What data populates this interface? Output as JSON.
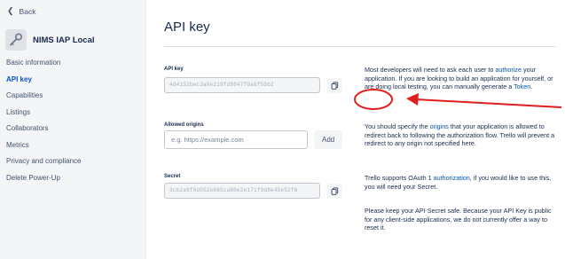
{
  "sidebar": {
    "back_label": "Back",
    "app_name": "NIMS IAP Local",
    "items": [
      {
        "label": "Basic information",
        "active": false
      },
      {
        "label": "API key",
        "active": true
      },
      {
        "label": "Capabilities",
        "active": false
      },
      {
        "label": "Listings",
        "active": false
      },
      {
        "label": "Collaborators",
        "active": false
      },
      {
        "label": "Metrics",
        "active": false
      },
      {
        "label": "Privacy and compliance",
        "active": false
      },
      {
        "label": "Delete Power-Up",
        "active": false
      }
    ]
  },
  "main": {
    "title": "API key",
    "api_key": {
      "label": "API key",
      "masked_value": "4d4152bec3a0e219fd9847f0a6f59b2"
    },
    "origins": {
      "label": "Allowed origins",
      "placeholder": "e.g. https://example.com",
      "add_label": "Add"
    },
    "secret": {
      "label": "Secret",
      "masked_value": "3cb2a9f0d052e865ca80e2e171f0d8e45e52f6"
    },
    "help": {
      "api_key_pre": "Most developers will need to ask each user to ",
      "api_key_link": "authorize",
      "api_key_mid": " your application. If you are looking to build an application for yourself, or are doing local testing, you can manually generate a ",
      "api_key_token_link": "Token",
      "api_key_post": ".",
      "origins_pre": "You should specify the ",
      "origins_link": "origins",
      "origins_post": " that your application is allowed to redirect back to following the authorization flow. Trello will prevent a redirect to any origin not specified here.",
      "secret_pre": "Trello supports OAuth 1 ",
      "secret_link": "authorization",
      "secret_post": ", if you would like to use this, you will need your Secret.",
      "secret_note": "Please keep your API Secret safe. Because your API Key is public for any client-side applications, we do not currently offer a way to reset it."
    }
  },
  "icons": {
    "back": "chevron-left-icon",
    "app": "app-icon",
    "copy": "copy-icon"
  },
  "colors": {
    "link": "#0052cc",
    "annotation": "#e01e1e"
  }
}
